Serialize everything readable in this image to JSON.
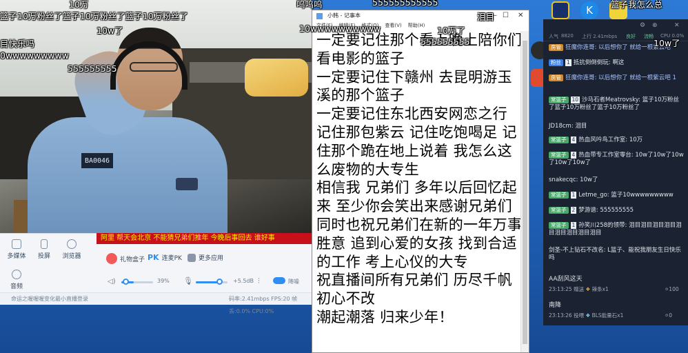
{
  "notepad": {
    "title": "小韩 - 记事本",
    "menu": [
      "文件(F)",
      "编辑(E)",
      "格式(O)",
      "查看(V)",
      "帮助(H)"
    ],
    "content": "一定要记住那个看上晚上陪你们看电影的篮子\n一定要记住下赣州 去昆明游玉溪的那个篮子\n一定要记住东北西安网恋之行 记住那包紫云 记住吃饱喝足 记住那个跪在地上说着 我怎么这么废物的大专生\n相信我 兄弟们 多年以后回忆起来 至少你会笑出来感谢兄弟们 同时也祝兄弟们在新的一年万事胜意 追到心爱的女孩 找到合适的工作 考上心仪的大专\n祝直播间所有兄弟们 历尽千帆 初心不改\n潮起潮落 归来少年！"
  },
  "webcam": {
    "badge_text": "BA0046"
  },
  "tool_panel": {
    "ticker": "阿里 帮天会北京 不能猜兄弟们推年 今晚后事回去 谁好事",
    "buttons": [
      {
        "label": "多媒体",
        "icon": "media-icon"
      },
      {
        "label": "投屏",
        "icon": "phone-icon"
      },
      {
        "label": "浏览器",
        "icon": "globe-icon"
      },
      {
        "label": "音频",
        "icon": "music-icon"
      }
    ],
    "features": [
      {
        "label": "礼物盒子",
        "icon": "gift-icon",
        "color": "#f25a5a"
      },
      {
        "label": "连麦PK",
        "icon": "pk-icon",
        "color": "#2f8ef0"
      },
      {
        "label": "更多应用",
        "icon": "grid-icon",
        "color": "#8a96a8"
      }
    ],
    "volume_pct": "39%",
    "mic_db": "+5.5dB",
    "noise_toggle_label": "降噪",
    "status_left": "命运之喔喔喔变化最小直播登录",
    "status_right": "码率:2.41mbps  FPS:20  帧丢:0.0%  CPU:0%"
  },
  "chat": {
    "stats": {
      "popularity_label": "人气",
      "popularity": "8820",
      "upload": "上行 2.41mbps",
      "ok1": "良好",
      "ok2": "流畅",
      "cpu": "CPU 0.0%"
    },
    "messages": [
      {
        "tag": "房管",
        "tag_color": "#d08a2c",
        "text": "狂魔你连哥: 以后想你了 就给一根紫云吧"
      },
      {
        "tag": "粉丝",
        "tag_color": "#3b7de0",
        "level": "1",
        "text": "抵抗倒倒倒玩: 啊这"
      },
      {
        "tag": "房管",
        "tag_color": "#d08a2c",
        "text": "狂魔你连哥: 以后想你了 就给一根紫云吧 1"
      },
      {
        "tag": "常篮子",
        "tag_color": "#4aa76a",
        "level": "10",
        "text": "沙马石者Meatrovsky: 篮子10万粉丝了篮子10万粉丝了篮子10万粉丝了"
      },
      {
        "text": "JD18cm: 泪目"
      },
      {
        "tag": "常篮子",
        "tag_color": "#4aa76a",
        "level": "4",
        "text": "热血风吟鸟工作室: 10万"
      },
      {
        "tag": "常篮子",
        "tag_color": "#4aa76a",
        "level": "4",
        "text": "热血带专工作室零台: 10w了10w了10w了10w了10w了"
      },
      {
        "text": "snakecqc: 10w了"
      },
      {
        "tag": "常篮子",
        "tag_color": "#4aa76a",
        "level": "1",
        "text": "Letme_go: 篮子10wwwwwwwww"
      },
      {
        "tag": "常篮子",
        "tag_color": "#4aa76a",
        "level": "2",
        "text": "梦游谱: 555555555"
      },
      {
        "tag": "常篮子",
        "tag_color": "#4aa76a",
        "level": "1",
        "text": "孙笑川258的领带: 泪目泪目泪目泪目泪目泪目泪目泪目泪目"
      },
      {
        "text": "剑圣-不上钻石不改名: L篮子、能祝我朋友生日快乐吗"
      }
    ],
    "gifts": [
      {
        "user": "AA刮风这天",
        "time": "23:13:25",
        "action": "赠送",
        "item": "辣条x1",
        "value": "100"
      },
      {
        "user": "南降",
        "time": "23:13:26",
        "action": "投喂",
        "item": "BLS能量石x1",
        "value": "0"
      }
    ]
  },
  "danmaku": [
    "10万",
    "篮子10万粉丝了篮子10万粉丝了篮子10万粉丝了",
    "呜呜呜",
    "555555555555",
    "泪目",
    "篮子我怎么总",
    "10w了",
    "目快乐吗",
    "0wwwwwwwww",
    "555555555",
    "10wwwwwwwwww",
    "10万了",
    "555555555",
    "10w了"
  ],
  "colors": {
    "accent": "#2f8ef0",
    "chat_bg": "#1b2231",
    "ticker_bg": "#c8101b"
  }
}
